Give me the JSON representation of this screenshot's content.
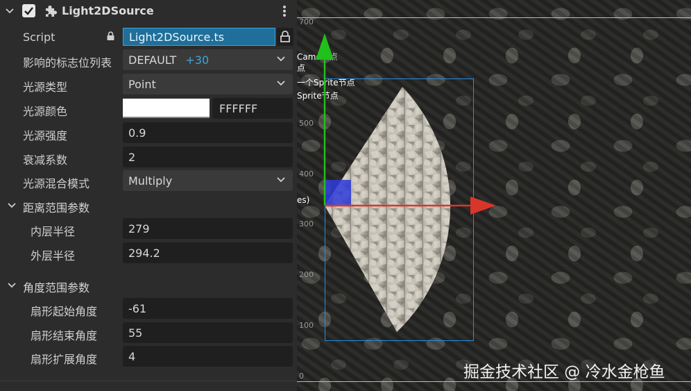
{
  "component": {
    "name": "Light2DSource",
    "enabled": true
  },
  "props": {
    "script_label": "Script",
    "script_value": "Light2DSource.ts",
    "layers_label": "影响的标志位列表",
    "layers_value": "DEFAULT",
    "layers_extra": "+30",
    "type_label": "光源类型",
    "type_value": "Point",
    "color_label": "光源颜色",
    "color_hex": "FFFFFF",
    "intensity_label": "光源强度",
    "intensity_value": "0.9",
    "falloff_label": "衰减系数",
    "falloff_value": "2",
    "blend_label": "光源混合模式",
    "blend_value": "Multiply"
  },
  "range_section": {
    "title": "距离范围参数",
    "inner_label": "内层半径",
    "inner_value": "279",
    "outer_label": "外层半径",
    "outer_value": "294.2"
  },
  "angle_section": {
    "title": "角度范围参数",
    "start_label": "扇形起始角度",
    "start_value": "-61",
    "end_label": "扇形结束角度",
    "end_value": "55",
    "spread_label": "扇形扩展角度",
    "spread_value": "4"
  },
  "scene": {
    "ruler": [
      "700",
      "500",
      "400",
      "300",
      "200",
      "100",
      "0"
    ],
    "overlay_1": "Came",
    "overlay_1b": "节点",
    "overlay_2": "点",
    "overlay_3": "一个Sprite节点",
    "overlay_4": "Sprite节点",
    "overlay_5": "es)"
  },
  "watermark": "掘金技术社区 @ 冷水金枪鱼",
  "colors": {
    "accent": "#1f6f9a",
    "accent_text": "#3aa6d8",
    "x_axis": "#d9362b",
    "y_axis": "#22c01c",
    "bbox": "#2a8ce0"
  }
}
